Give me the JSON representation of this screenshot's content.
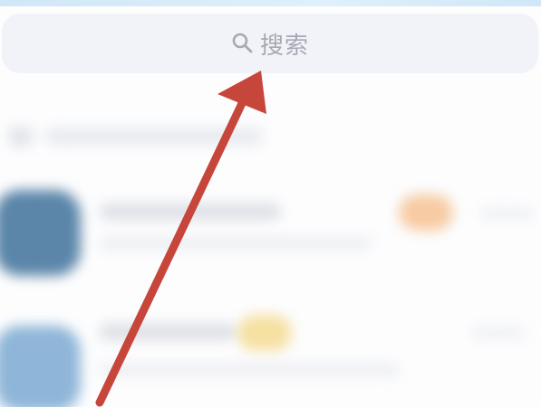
{
  "search": {
    "placeholder": "搜索",
    "icon": "search-icon"
  },
  "annotation": {
    "type": "arrow",
    "color": "#c7463b",
    "points_to": "search-bar"
  },
  "background": {
    "blurred": true
  }
}
